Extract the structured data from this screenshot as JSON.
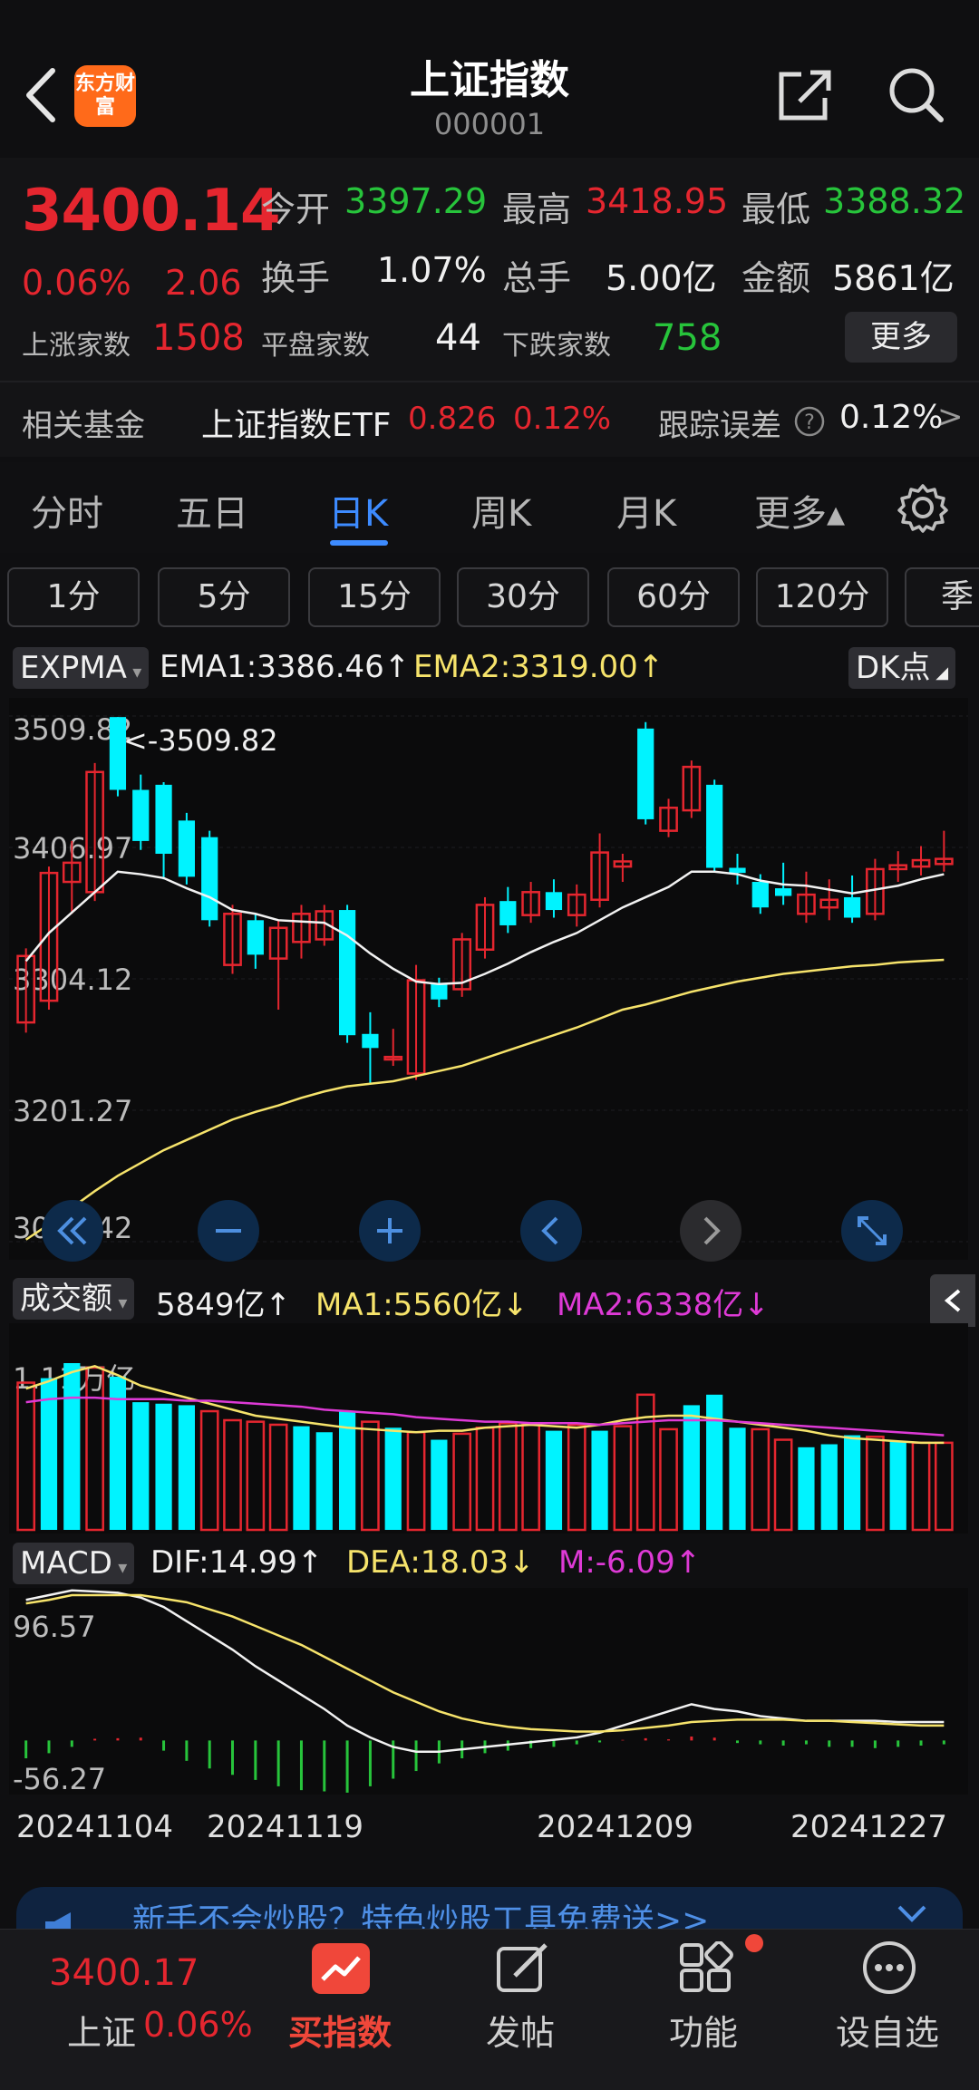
{
  "header": {
    "title": "上证指数",
    "code": "000001",
    "logo_text": "东方财富"
  },
  "quote": {
    "price": "3400.14",
    "change_pct": "0.06%",
    "change": "2.06",
    "open_label": "今开",
    "open": "3397.29",
    "high_label": "最高",
    "high": "3418.95",
    "low_label": "最低",
    "low": "3388.32",
    "turnover_label": "换手",
    "turnover": "1.07%",
    "volume_label": "总手",
    "volume": "5.00亿",
    "amount_label": "金额",
    "amount": "5861亿",
    "up_label": "上涨家数",
    "up": "1508",
    "flat_label": "平盘家数",
    "flat": "44",
    "down_label": "下跌家数",
    "down": "758",
    "more_label": "更多"
  },
  "fund": {
    "label": "相关基金",
    "name": "上证指数ETF",
    "price": "0.826",
    "pct": "0.12%",
    "tracking_label": "跟踪误差",
    "tracking_value": "0.12%",
    "arrow": ">"
  },
  "tabs": [
    "分时",
    "五日",
    "日K",
    "周K",
    "月K",
    "更多▴"
  ],
  "active_tab": "日K",
  "minute_buttons": [
    "1分",
    "5分",
    "15分",
    "30分",
    "60分",
    "120分",
    "季"
  ],
  "main_indicator": {
    "name": "EXPMA",
    "ema1": "EMA1:3386.46↑",
    "ema2": "EMA2:3319.00↑",
    "dk_label": "DK点"
  },
  "vol_indicator": {
    "name": "成交额",
    "value": "5849亿↑",
    "ma1": "MA1:5560亿↓",
    "ma2": "MA2:6338亿↓",
    "ylabel": "1.11万亿"
  },
  "macd_indicator": {
    "name": "MACD",
    "dif": "DIF:14.99↑",
    "dea": "DEA:18.03↓",
    "m": "M:-6.09↑",
    "top": "96.57",
    "bottom": "-56.27"
  },
  "dates": [
    "20241104",
    "20241119",
    "20241209",
    "20241227"
  ],
  "banner_text": "新手不会炒股？特色炒股工具免费送>>",
  "bottom_nav": {
    "index_price": "3400.17",
    "index_name": "上证",
    "index_pct": "0.06%",
    "buy": "买指数",
    "post": "发帖",
    "func": "功能",
    "watch": "设自选"
  },
  "colors": {
    "up": "#e5262f",
    "down": "#27c43b",
    "accent": "#3d8bff",
    "cyan": "#00f3ff"
  },
  "chart_data": {
    "type": "candlestick",
    "y_ticks": [
      3509.82,
      3406.97,
      3304.12,
      3201.27,
      3098.42
    ],
    "ylim": [
      3098.42,
      3509.82
    ],
    "high_marker": "<-3509.82",
    "candles": [
      {
        "o": 3270,
        "c": 3322,
        "h": 3328,
        "l": 3262
      },
      {
        "o": 3287,
        "c": 3387,
        "h": 3392,
        "l": 3280
      },
      {
        "o": 3380,
        "c": 3395,
        "h": 3412,
        "l": 3355
      },
      {
        "o": 3372,
        "c": 3466,
        "h": 3473,
        "l": 3365
      },
      {
        "o": 3509,
        "c": 3452,
        "h": 3509,
        "l": 3447
      },
      {
        "o": 3452,
        "c": 3412,
        "h": 3464,
        "l": 3405
      },
      {
        "o": 3456,
        "c": 3402,
        "h": 3458,
        "l": 3382
      },
      {
        "o": 3428,
        "c": 3384,
        "h": 3434,
        "l": 3378
      },
      {
        "o": 3415,
        "c": 3350,
        "h": 3420,
        "l": 3345
      },
      {
        "o": 3315,
        "c": 3355,
        "h": 3362,
        "l": 3308
      },
      {
        "o": 3350,
        "c": 3323,
        "h": 3355,
        "l": 3312
      },
      {
        "o": 3320,
        "c": 3344,
        "h": 3350,
        "l": 3280
      },
      {
        "o": 3333,
        "c": 3355,
        "h": 3362,
        "l": 3320
      },
      {
        "o": 3335,
        "c": 3357,
        "h": 3362,
        "l": 3330
      },
      {
        "o": 3358,
        "c": 3260,
        "h": 3362,
        "l": 3254
      },
      {
        "o": 3261,
        "c": 3250,
        "h": 3278,
        "l": 3222
      },
      {
        "o": 3241,
        "c": 3243,
        "h": 3265,
        "l": 3236
      },
      {
        "o": 3230,
        "c": 3303,
        "h": 3315,
        "l": 3225
      },
      {
        "o": 3300,
        "c": 3288,
        "h": 3305,
        "l": 3282
      },
      {
        "o": 3296,
        "c": 3335,
        "h": 3340,
        "l": 3290
      },
      {
        "o": 3327,
        "c": 3362,
        "h": 3368,
        "l": 3320
      },
      {
        "o": 3365,
        "c": 3346,
        "h": 3376,
        "l": 3340
      },
      {
        "o": 3354,
        "c": 3372,
        "h": 3380,
        "l": 3348
      },
      {
        "o": 3372,
        "c": 3358,
        "h": 3382,
        "l": 3352
      },
      {
        "o": 3354,
        "c": 3370,
        "h": 3378,
        "l": 3345
      },
      {
        "o": 3366,
        "c": 3403,
        "h": 3418,
        "l": 3360
      },
      {
        "o": 3392,
        "c": 3396,
        "h": 3402,
        "l": 3380
      },
      {
        "o": 3500,
        "c": 3429,
        "h": 3505,
        "l": 3425
      },
      {
        "o": 3420,
        "c": 3438,
        "h": 3445,
        "l": 3415
      },
      {
        "o": 3436,
        "c": 3470,
        "h": 3475,
        "l": 3430
      },
      {
        "o": 3456,
        "c": 3391,
        "h": 3460,
        "l": 3388
      },
      {
        "o": 3391,
        "c": 3387,
        "h": 3402,
        "l": 3378
      },
      {
        "o": 3380,
        "c": 3360,
        "h": 3386,
        "l": 3355
      },
      {
        "o": 3375,
        "c": 3369,
        "h": 3395,
        "l": 3362
      },
      {
        "o": 3355,
        "c": 3370,
        "h": 3388,
        "l": 3348
      },
      {
        "o": 3360,
        "c": 3366,
        "h": 3382,
        "l": 3350
      },
      {
        "o": 3368,
        "c": 3352,
        "h": 3385,
        "l": 3348
      },
      {
        "o": 3355,
        "c": 3390,
        "h": 3398,
        "l": 3350
      },
      {
        "o": 3390,
        "c": 3393,
        "h": 3404,
        "l": 3380
      },
      {
        "o": 3392,
        "c": 3397,
        "h": 3408,
        "l": 3385
      },
      {
        "o": 3394,
        "c": 3398,
        "h": 3420,
        "l": 3388
      }
    ],
    "ema1": [
      3318,
      3340,
      3356,
      3372,
      3388,
      3386,
      3383,
      3375,
      3368,
      3358,
      3355,
      3350,
      3349,
      3348,
      3338,
      3324,
      3312,
      3302,
      3300,
      3301,
      3308,
      3316,
      3325,
      3333,
      3340,
      3350,
      3360,
      3368,
      3376,
      3388,
      3388,
      3386,
      3381,
      3378,
      3377,
      3374,
      3371,
      3374,
      3377,
      3382,
      3386
    ],
    "ema2": [
      3100,
      3112,
      3125,
      3138,
      3150,
      3160,
      3170,
      3178,
      3186,
      3194,
      3200,
      3205,
      3211,
      3216,
      3220,
      3222,
      3224,
      3228,
      3232,
      3236,
      3242,
      3248,
      3254,
      3260,
      3266,
      3273,
      3280,
      3284,
      3289,
      3294,
      3298,
      3302,
      3305,
      3308,
      3310,
      3312,
      3314,
      3315,
      3317,
      3318,
      3319
    ],
    "volume": {
      "values": [
        0.98,
        1.01,
        1.11,
        1.08,
        1.02,
        0.85,
        0.84,
        0.83,
        0.79,
        0.73,
        0.72,
        0.7,
        0.69,
        0.65,
        0.79,
        0.72,
        0.68,
        0.65,
        0.6,
        0.64,
        0.68,
        0.71,
        0.7,
        0.66,
        0.7,
        0.66,
        0.69,
        0.9,
        0.67,
        0.83,
        0.9,
        0.68,
        0.67,
        0.6,
        0.55,
        0.57,
        0.63,
        0.62,
        0.59,
        0.58,
        0.58
      ],
      "colors": [
        "r",
        "c",
        "c",
        "r",
        "c",
        "c",
        "c",
        "c",
        "r",
        "r",
        "r",
        "r",
        "c",
        "c",
        "c",
        "r",
        "c",
        "r",
        "c",
        "r",
        "r",
        "r",
        "r",
        "c",
        "r",
        "c",
        "r",
        "r",
        "r",
        "c",
        "c",
        "c",
        "r",
        "r",
        "c",
        "c",
        "c",
        "r",
        "c",
        "r",
        "r"
      ],
      "ma1": [
        0.94,
        0.99,
        1.05,
        1.09,
        1.03,
        0.96,
        0.92,
        0.88,
        0.84,
        0.8,
        0.76,
        0.74,
        0.72,
        0.7,
        0.68,
        0.67,
        0.66,
        0.65,
        0.66,
        0.66,
        0.68,
        0.69,
        0.7,
        0.69,
        0.68,
        0.7,
        0.73,
        0.75,
        0.76,
        0.76,
        0.74,
        0.72,
        0.7,
        0.68,
        0.66,
        0.63,
        0.61,
        0.6,
        0.59,
        0.58,
        0.58
      ],
      "ma2": [
        0.85,
        0.87,
        0.88,
        0.88,
        0.87,
        0.87,
        0.87,
        0.86,
        0.86,
        0.85,
        0.84,
        0.83,
        0.82,
        0.8,
        0.79,
        0.78,
        0.77,
        0.75,
        0.74,
        0.73,
        0.72,
        0.72,
        0.71,
        0.71,
        0.71,
        0.7,
        0.71,
        0.72,
        0.73,
        0.73,
        0.73,
        0.72,
        0.71,
        0.7,
        0.69,
        0.68,
        0.67,
        0.66,
        0.65,
        0.64,
        0.63
      ],
      "ymax": 1.11
    },
    "macd": {
      "dif": [
        88,
        92,
        96,
        95,
        94,
        90,
        82,
        70,
        58,
        46,
        32,
        20,
        8,
        -4,
        -18,
        -28,
        -36,
        -40,
        -40,
        -38,
        -36,
        -34,
        -32,
        -30,
        -28,
        -24,
        -18,
        -12,
        -6,
        0,
        -4,
        -6,
        -10,
        -12,
        -14,
        -14,
        -14,
        -14,
        -15,
        -15,
        -15
      ],
      "dea": [
        85,
        88,
        92,
        92,
        92,
        92,
        89,
        86,
        80,
        74,
        66,
        58,
        50,
        40,
        30,
        20,
        10,
        2,
        -6,
        -12,
        -16,
        -19,
        -21,
        -22,
        -23,
        -23,
        -22,
        -20,
        -18,
        -15,
        -14,
        -13,
        -13,
        -13,
        -14,
        -14,
        -15,
        -16,
        -17,
        -18,
        -18
      ],
      "hist": [
        -28,
        -20,
        -10,
        6,
        8,
        10,
        -16,
        -32,
        -44,
        -54,
        -62,
        -72,
        -78,
        -80,
        -82,
        -72,
        -60,
        -48,
        -36,
        -28,
        -20,
        -16,
        -12,
        -10,
        -6,
        -3,
        2,
        8,
        4,
        14,
        10,
        -4,
        -6,
        -8,
        -6,
        -10,
        -10,
        -12,
        -10,
        -8,
        -6
      ],
      "ylim": [
        -56.27,
        96.57
      ]
    }
  }
}
